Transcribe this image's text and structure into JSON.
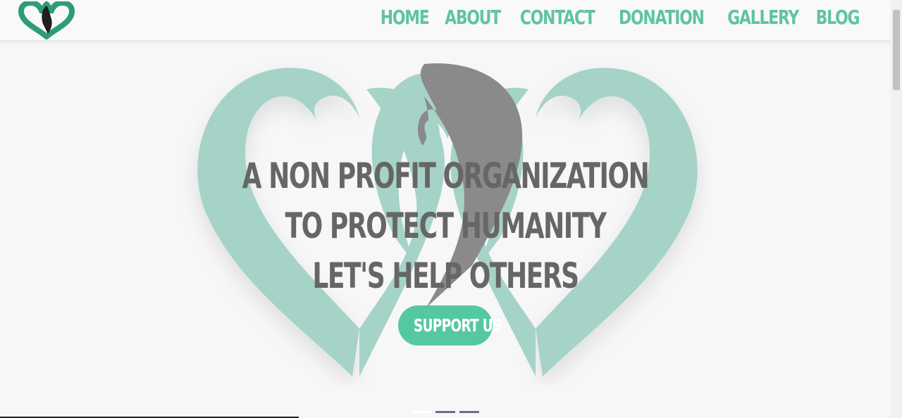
{
  "nav": {
    "items": [
      {
        "label": "HOME"
      },
      {
        "label": "ABOUT"
      },
      {
        "label": "CONTACT"
      },
      {
        "label": "DONATION"
      },
      {
        "label": "GALLERY"
      },
      {
        "label": "BLOG"
      }
    ]
  },
  "logo": {
    "icon": "double-heart-ribbon-icon"
  },
  "hero": {
    "headline": [
      "A NON PROFIT ORGANIZATION",
      "TO PROTECT HUMANITY",
      "LET'S HELP OTHERS"
    ],
    "button_label": "SUPPORT US",
    "prev_icon": "chevron-left-icon",
    "next_icon": "chevron-right-icon",
    "prev_glyph": "‹",
    "next_glyph": "›",
    "slides_count": 3,
    "active_slide": 1
  },
  "colors": {
    "brand_teal": "#5ec4a0",
    "heart_teal": "#a6d3c7",
    "ribbon_gray": "#8a8a8a",
    "text_gray": "#666666",
    "button": "#55c8a0"
  }
}
